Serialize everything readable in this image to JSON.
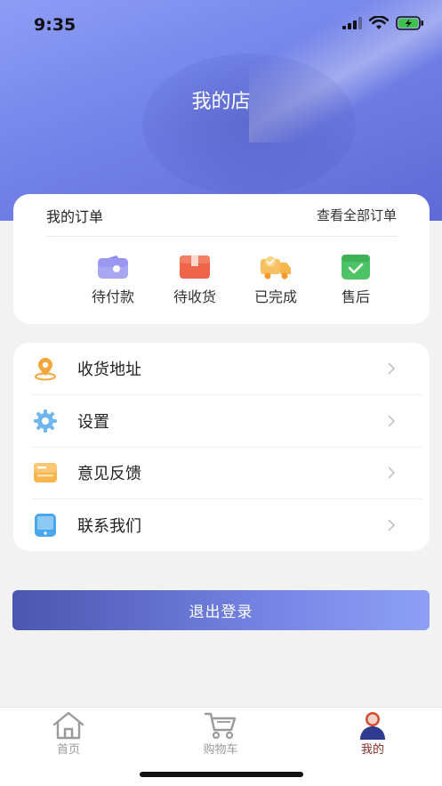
{
  "status_bar": {
    "time": "9:35"
  },
  "header": {
    "title": "我的店"
  },
  "orders": {
    "title": "我的订单",
    "view_all": "查看全部订单",
    "items": [
      {
        "label": "待付款",
        "icon": "wallet-icon",
        "color": "#8f8cf0"
      },
      {
        "label": "待收货",
        "icon": "box-icon",
        "color": "#f0654a"
      },
      {
        "label": "已完成",
        "icon": "truck-icon",
        "color": "#f7b54b"
      },
      {
        "label": "售后",
        "icon": "check-box-icon",
        "color": "#4cc466"
      }
    ]
  },
  "menu": {
    "items": [
      {
        "label": "收货地址",
        "icon": "location-pin-icon"
      },
      {
        "label": "设置",
        "icon": "gear-icon"
      },
      {
        "label": "意见反馈",
        "icon": "feedback-icon"
      },
      {
        "label": "联系我们",
        "icon": "contact-icon"
      }
    ]
  },
  "logout": {
    "label": "退出登录"
  },
  "tabbar": {
    "items": [
      {
        "label": "首页",
        "icon": "home-icon",
        "active": false
      },
      {
        "label": "购物车",
        "icon": "cart-icon",
        "active": false
      },
      {
        "label": "我的",
        "icon": "user-icon",
        "active": true
      }
    ],
    "active_color": "#8b2a22",
    "inactive_color": "#9a9a9a"
  }
}
